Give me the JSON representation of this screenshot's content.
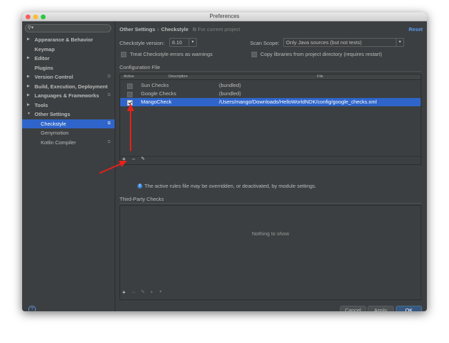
{
  "window": {
    "title": "Preferences"
  },
  "sidebar": {
    "search_icon": "magnifier-icon",
    "items": [
      {
        "label": "Appearance & Behavior",
        "expanded": false
      },
      {
        "label": "Keymap"
      },
      {
        "label": "Editor",
        "expanded": false
      },
      {
        "label": "Plugins"
      },
      {
        "label": "Version Control",
        "expanded": false
      },
      {
        "label": "Build, Execution, Deployment",
        "expanded": false
      },
      {
        "label": "Languages & Frameworks",
        "expanded": false
      },
      {
        "label": "Tools",
        "expanded": false
      },
      {
        "label": "Other Settings",
        "expanded": true
      },
      {
        "label": "Checkstyle",
        "selected": true
      },
      {
        "label": "Genymotion"
      },
      {
        "label": "Kotlin Compiler"
      }
    ]
  },
  "breadcrumb": {
    "parent": "Other Settings",
    "separator": "›",
    "current": "Checkstyle",
    "scope": "For current project"
  },
  "reset_label": "Reset",
  "settings": {
    "version_label": "Checkstyle version:",
    "version_value": "8.10",
    "scan_label": "Scan Scope:",
    "scan_value": "Only Java sources (but not tests)",
    "treat_errors_label": "Treat Checkstyle errors as warnings",
    "copy_libs_label": "Copy libraries from project directory (requires restart)"
  },
  "config": {
    "title": "Configuration File",
    "columns": {
      "active": "Active",
      "description": "Description",
      "file": "File"
    },
    "rows": [
      {
        "active": false,
        "description": "Sun Checks",
        "file": "(bundled)",
        "selected": false
      },
      {
        "active": false,
        "description": "Google Checks",
        "file": "(bundled)",
        "selected": false
      },
      {
        "active": true,
        "description": "MangoCheck",
        "file": "/Users/mango/Downloads/HelloWorldNDK/config/google_checks.xml",
        "selected": true
      }
    ],
    "toolbar": {
      "add": "+",
      "remove": "−",
      "edit": "✎"
    }
  },
  "info_text": "The active rules file may be overridden, or deactivated, by module settings.",
  "third_party": {
    "title": "Third-Party Checks",
    "empty_text": "Nothing to show",
    "toolbar": {
      "add": "+",
      "remove": "−",
      "edit": "✎",
      "up": "▲",
      "down": "▼"
    }
  },
  "buttons": {
    "cancel": "Cancel",
    "apply": "Apply",
    "ok": "OK"
  },
  "help_label": "?",
  "colors": {
    "accent": "#2f65ca",
    "annotation_arrow": "#e8201a",
    "link": "#589df6"
  }
}
